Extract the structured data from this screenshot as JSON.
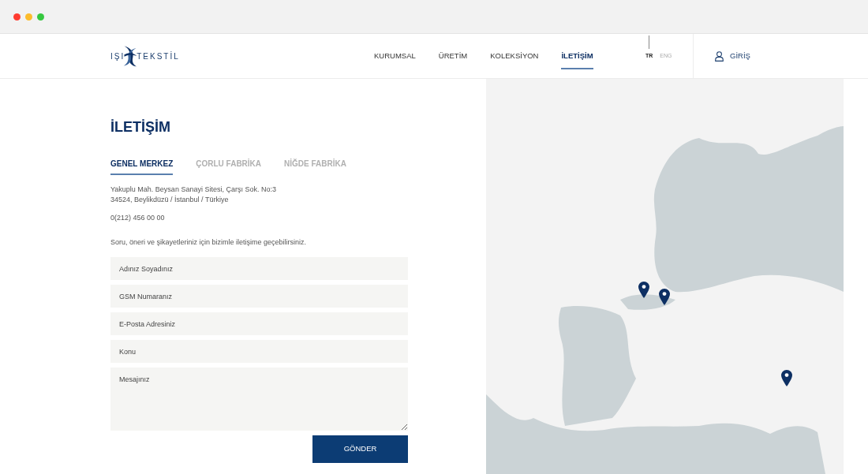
{
  "window_controls": [
    {
      "color": "#ff3b30"
    },
    {
      "color": "#fcbc2c"
    },
    {
      "color": "#36c840"
    }
  ],
  "header": {
    "logo": {
      "left": "IŞI",
      "right": "TEKSTİL"
    },
    "nav": [
      {
        "label": "KURUMSAL",
        "selected": false
      },
      {
        "label": "ÜRETİM",
        "selected": false
      },
      {
        "label": "KOLEKSİYON",
        "selected": false
      },
      {
        "label": "İLETİŞİM",
        "selected": true
      }
    ],
    "languages": [
      {
        "label": "TR",
        "selected": true
      },
      {
        "label": "ENG",
        "selected": false
      }
    ],
    "login": "GİRİŞ"
  },
  "contact": {
    "title": "İLETİŞİM",
    "tabs": [
      {
        "label": "GENEL MERKEZ",
        "selected": true
      },
      {
        "label": "ÇORLU FABRİKA",
        "selected": false
      },
      {
        "label": "NİĞDE FABRİKA",
        "selected": false
      }
    ],
    "address": [
      "Yakuplu Mah. Beysan Sanayi Sitesi, Çarşı Sok. No:3",
      "34524, Beylikdüzü / İstanbul / Türkiye"
    ],
    "phone": "0(212) 456 00 00",
    "intro": "Soru, öneri ve şikayetleriniz için bizimle iletişime geçebilirsiniz.",
    "form": {
      "fields": [
        {
          "kind": "input",
          "placeholder": "Adınız Soyadınız"
        },
        {
          "kind": "input",
          "placeholder": "GSM Numaranız"
        },
        {
          "kind": "input",
          "placeholder": "E-Posta Adresiniz"
        },
        {
          "kind": "input",
          "placeholder": "Konu"
        },
        {
          "kind": "textarea",
          "placeholder": "Mesajınız"
        }
      ],
      "submit": "GÖNDER"
    }
  }
}
